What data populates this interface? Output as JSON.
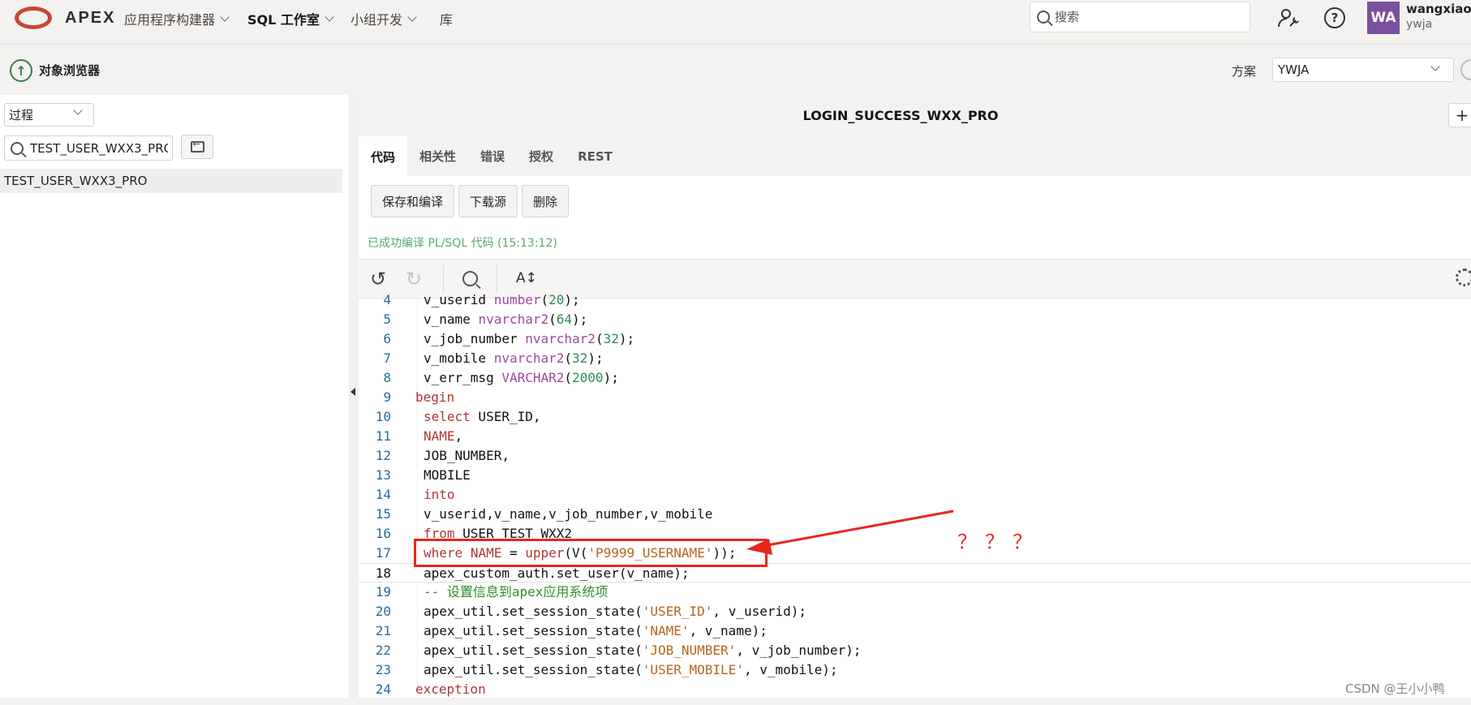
{
  "brand": {
    "name": "APEX"
  },
  "nav": {
    "items": [
      {
        "label": "应用程序构建器",
        "has_menu": true,
        "active": false
      },
      {
        "label": "SQL 工作室",
        "has_menu": true,
        "active": true
      },
      {
        "label": "小组开发",
        "has_menu": true,
        "active": false
      },
      {
        "label": "库",
        "has_menu": false,
        "active": false
      }
    ],
    "search_placeholder": "搜索"
  },
  "user": {
    "initials": "WA",
    "name": "wangxiaox",
    "workspace": "ywja"
  },
  "object_browser": {
    "title": "对象浏览器",
    "schema_label": "方案",
    "schema_value": "YWJA",
    "type_select": "过程",
    "filter_value": "TEST_USER_WXX3_PRO",
    "list": [
      "TEST_USER_WXX3_PRO"
    ]
  },
  "object": {
    "name": "LOGIN_SUCCESS_WXX_PRO",
    "tabs": [
      {
        "label": "代码",
        "active": true
      },
      {
        "label": "相关性",
        "active": false
      },
      {
        "label": "错误",
        "active": false
      },
      {
        "label": "授权",
        "active": false
      },
      {
        "label": "REST",
        "active": false
      }
    ],
    "buttons": {
      "save_compile": "保存和编译",
      "download": "下载源",
      "delete": "删除"
    },
    "status": "已成功编译 PL/SQL 代码 (15:13:12)"
  },
  "editor": {
    "toolbar": {
      "undo": "↺",
      "redo": "↻",
      "font_size": "A↕"
    },
    "lines": [
      {
        "n": "4",
        "indent": 1,
        "tokens": [
          [
            "v_userid ",
            ""
          ],
          [
            "number",
            "ty"
          ],
          [
            "(",
            ""
          ],
          [
            "20",
            "nm"
          ],
          [
            ");",
            ""
          ]
        ]
      },
      {
        "n": "5",
        "indent": 1,
        "tokens": [
          [
            "v_name ",
            ""
          ],
          [
            "nvarchar2",
            "ty"
          ],
          [
            "(",
            ""
          ],
          [
            "64",
            "nm"
          ],
          [
            ");",
            ""
          ]
        ]
      },
      {
        "n": "6",
        "indent": 1,
        "tokens": [
          [
            "v_job_number ",
            ""
          ],
          [
            "nvarchar2",
            "ty"
          ],
          [
            "(",
            ""
          ],
          [
            "32",
            "nm"
          ],
          [
            ");",
            ""
          ]
        ]
      },
      {
        "n": "7",
        "indent": 1,
        "tokens": [
          [
            "v_mobile ",
            ""
          ],
          [
            "nvarchar2",
            "ty"
          ],
          [
            "(",
            ""
          ],
          [
            "32",
            "nm"
          ],
          [
            ");",
            ""
          ]
        ]
      },
      {
        "n": "8",
        "indent": 1,
        "tokens": [
          [
            "v_err_msg ",
            ""
          ],
          [
            "VARCHAR2",
            "ty"
          ],
          [
            "(",
            ""
          ],
          [
            "2000",
            "nm"
          ],
          [
            ");",
            ""
          ]
        ]
      },
      {
        "n": "9",
        "indent": 0,
        "tokens": [
          [
            "begin",
            "kw"
          ]
        ]
      },
      {
        "n": "10",
        "indent": 1,
        "tokens": [
          [
            "select",
            "kw"
          ],
          [
            " USER_ID,",
            ""
          ]
        ]
      },
      {
        "n": "11",
        "indent": 1,
        "tokens": [
          [
            "NAME",
            "kw"
          ],
          [
            ",",
            ""
          ]
        ]
      },
      {
        "n": "12",
        "indent": 1,
        "tokens": [
          [
            "JOB_NUMBER,",
            ""
          ]
        ]
      },
      {
        "n": "13",
        "indent": 1,
        "tokens": [
          [
            "MOBILE",
            ""
          ]
        ]
      },
      {
        "n": "14",
        "indent": 1,
        "tokens": [
          [
            "into",
            "kw"
          ]
        ]
      },
      {
        "n": "15",
        "indent": 1,
        "tokens": [
          [
            "v_userid,v_name,v_job_number,v_mobile",
            ""
          ]
        ]
      },
      {
        "n": "16",
        "indent": 1,
        "tokens": [
          [
            "from",
            "kw"
          ],
          [
            " USER_TEST_WXX2",
            ""
          ]
        ]
      },
      {
        "n": "17",
        "indent": 1,
        "tokens": [
          [
            "where",
            "kw"
          ],
          [
            " ",
            ""
          ],
          [
            "NAME",
            "kw"
          ],
          [
            " = ",
            ""
          ],
          [
            "upper",
            "kw"
          ],
          [
            "(V(",
            ""
          ],
          [
            "'P9999_USERNAME'",
            "st"
          ],
          [
            "));",
            ""
          ]
        ]
      },
      {
        "n": "18",
        "indent": 1,
        "current": true,
        "tokens": [
          [
            "apex_custom_auth.set_user(v_name);",
            ""
          ]
        ]
      },
      {
        "n": "19",
        "indent": 1,
        "tokens": [
          [
            "-- 设置信息到apex应用系统项",
            "cm"
          ]
        ]
      },
      {
        "n": "20",
        "indent": 1,
        "tokens": [
          [
            "apex_util.set_session_state(",
            ""
          ],
          [
            "'USER_ID'",
            "st"
          ],
          [
            ", v_userid);",
            ""
          ]
        ]
      },
      {
        "n": "21",
        "indent": 1,
        "tokens": [
          [
            "apex_util.set_session_state(",
            ""
          ],
          [
            "'NAME'",
            "st"
          ],
          [
            ", v_name);",
            ""
          ]
        ]
      },
      {
        "n": "22",
        "indent": 1,
        "tokens": [
          [
            "apex_util.set_session_state(",
            ""
          ],
          [
            "'JOB_NUMBER'",
            "st"
          ],
          [
            ", v_job_number);",
            ""
          ]
        ]
      },
      {
        "n": "23",
        "indent": 1,
        "tokens": [
          [
            "apex_util.set_session_state(",
            ""
          ],
          [
            "'USER_MOBILE'",
            "st"
          ],
          [
            ", v_mobile);",
            ""
          ]
        ]
      },
      {
        "n": "24",
        "indent": 0,
        "tokens": [
          [
            "exception",
            "kw"
          ]
        ]
      }
    ]
  },
  "annotation": {
    "text": "？？？",
    "color": "#e8251f"
  },
  "watermark": "CSDN @王小小鸭",
  "colors": {
    "brand_red": "#c74634",
    "avatar": "#7b4f9e",
    "status_green": "#5aa870",
    "annotation_red": "#e8251f"
  }
}
